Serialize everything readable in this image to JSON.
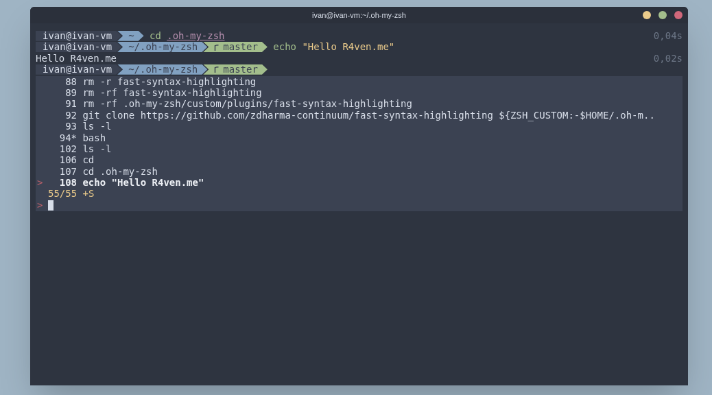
{
  "window": {
    "title": "ivan@ivan-vm:~/.oh-my-zsh"
  },
  "lines": [
    {
      "kind": "prompt",
      "segments": [
        {
          "kind": "host",
          "text": "ivan@ivan-vm"
        },
        {
          "kind": "path",
          "text": "~"
        }
      ],
      "command": [
        {
          "kind": "cmd",
          "text": "cd"
        },
        {
          "kind": "path",
          "text": ".oh-my-zsh"
        }
      ],
      "duration": "0,04s"
    },
    {
      "kind": "prompt",
      "segments": [
        {
          "kind": "host",
          "text": "ivan@ivan-vm"
        },
        {
          "kind": "path",
          "text": "~/.oh-my-zsh"
        },
        {
          "kind": "git",
          "text": "master"
        }
      ],
      "command": [
        {
          "kind": "cmd",
          "text": "echo"
        },
        {
          "kind": "string",
          "text": "\"Hello R4ven.me\""
        }
      ]
    },
    {
      "kind": "output",
      "text": "Hello R4ven.me",
      "duration": "0,02s"
    },
    {
      "kind": "prompt",
      "segments": [
        {
          "kind": "host",
          "text": "ivan@ivan-vm"
        },
        {
          "kind": "path",
          "text": "~/.oh-my-zsh"
        },
        {
          "kind": "git",
          "text": "master"
        }
      ]
    }
  ],
  "history": {
    "pointer": ">",
    "entries": [
      {
        "number": "88",
        "command": "rm -r fast-syntax-highlighting",
        "selected": false
      },
      {
        "number": "89",
        "command": "rm -rf fast-syntax-highlighting",
        "selected": false
      },
      {
        "number": "91",
        "command": "rm -rf .oh-my-zsh/custom/plugins/fast-syntax-highlighting",
        "selected": false
      },
      {
        "number": "92",
        "command": "git clone https://github.com/zdharma-continuum/fast-syntax-highlighting ${ZSH_CUSTOM:-$HOME/.oh-m..",
        "selected": false
      },
      {
        "number": "93",
        "command": "ls -l",
        "selected": false
      },
      {
        "number": "94*",
        "command": "bash",
        "selected": false
      },
      {
        "number": "102",
        "command": "ls -l",
        "selected": false
      },
      {
        "number": "106",
        "command": "cd",
        "selected": false
      },
      {
        "number": "107",
        "command": "cd .oh-my-zsh",
        "selected": false
      },
      {
        "number": "108",
        "command": "echo \"Hello R4ven.me\"",
        "selected": true
      }
    ],
    "count": "55/55 +S"
  },
  "input": {
    "prompt": ">"
  }
}
